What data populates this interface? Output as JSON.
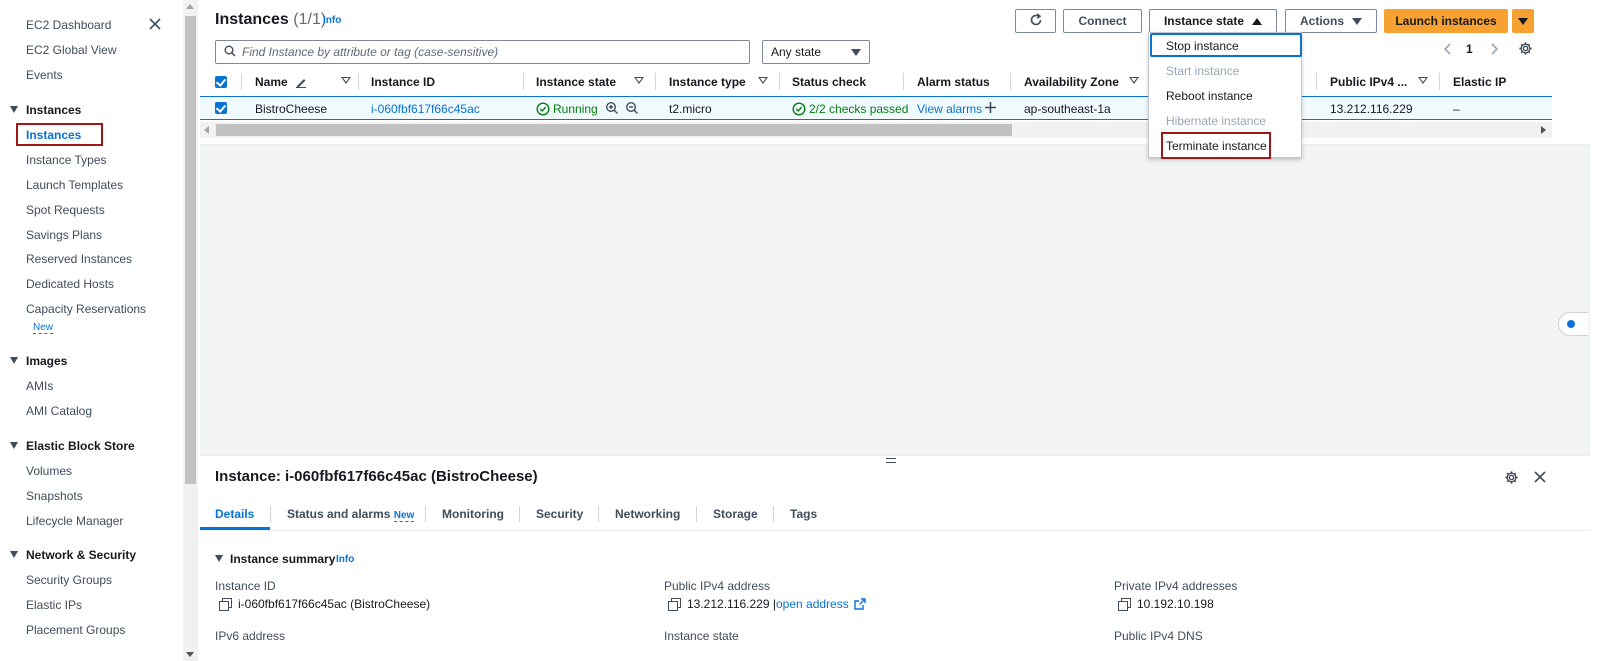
{
  "sidebar": {
    "items": [
      {
        "label": "EC2 Dashboard"
      },
      {
        "label": "EC2 Global View"
      },
      {
        "label": "Events"
      }
    ],
    "sections": [
      {
        "label": "Instances",
        "items": [
          "Instances",
          "Instance Types",
          "Launch Templates",
          "Spot Requests",
          "Savings Plans",
          "Reserved Instances",
          "Dedicated Hosts",
          "Capacity Reservations"
        ],
        "new_badge": "New"
      },
      {
        "label": "Images",
        "items": [
          "AMIs",
          "AMI Catalog"
        ]
      },
      {
        "label": "Elastic Block Store",
        "items": [
          "Volumes",
          "Snapshots",
          "Lifecycle Manager"
        ]
      },
      {
        "label": "Network & Security",
        "items": [
          "Security Groups",
          "Elastic IPs",
          "Placement Groups"
        ]
      }
    ]
  },
  "header": {
    "title": "Instances",
    "count": "(1/1)",
    "info": "Info",
    "connect_label": "Connect",
    "instance_state_label": "Instance state",
    "actions_label": "Actions",
    "launch_label": "Launch instances"
  },
  "filter": {
    "search_placeholder": "Find Instance by attribute or tag (case-sensitive)",
    "state_select": "Any state",
    "page": "1"
  },
  "table": {
    "columns": [
      "Name",
      "Instance ID",
      "Instance state",
      "Instance type",
      "Status check",
      "Alarm status",
      "Availability Zone",
      "Public IPv4 ...",
      "Elastic IP"
    ],
    "rows": [
      {
        "name": "BistroCheese",
        "instance_id": "i-060fbf617f66c45ac",
        "state": "Running",
        "type": "t2.micro",
        "status_check": "2/2 checks passed",
        "alarm": "View alarms",
        "az": "ap-southeast-1a",
        "public_ipv4": "13.212.116.229",
        "elastic_ip": "–"
      }
    ]
  },
  "dropdown": {
    "items": [
      {
        "label": "Stop instance",
        "enabled": true
      },
      {
        "label": "Start instance",
        "enabled": false
      },
      {
        "label": "Reboot instance",
        "enabled": true
      },
      {
        "label": "Hibernate instance",
        "enabled": false
      },
      {
        "label": "Terminate instance",
        "enabled": true
      }
    ]
  },
  "details": {
    "title": "Instance: i-060fbf617f66c45ac (BistroCheese)",
    "tabs": [
      "Details",
      "Status and alarms",
      "Monitoring",
      "Security",
      "Networking",
      "Storage",
      "Tags"
    ],
    "tab_new": "New",
    "summary_title": "Instance summary",
    "summary_info": "Info",
    "fields": {
      "instance_id_label": "Instance ID",
      "instance_id_value": "i-060fbf617f66c45ac (BistroCheese)",
      "public_ipv4_label": "Public IPv4 address",
      "public_ipv4_value": "13.212.116.229",
      "open_address": "open address",
      "private_ipv4_label": "Private IPv4 addresses",
      "private_ipv4_value": "10.192.10.198",
      "ipv6_label": "IPv6 address",
      "instance_state_label": "Instance state",
      "public_dns_label": "Public IPv4 DNS"
    }
  },
  "colors": {
    "accent": "#0972d3",
    "primary_button": "#f7a133",
    "success": "#037f0c",
    "highlight_box": "#a11616"
  }
}
